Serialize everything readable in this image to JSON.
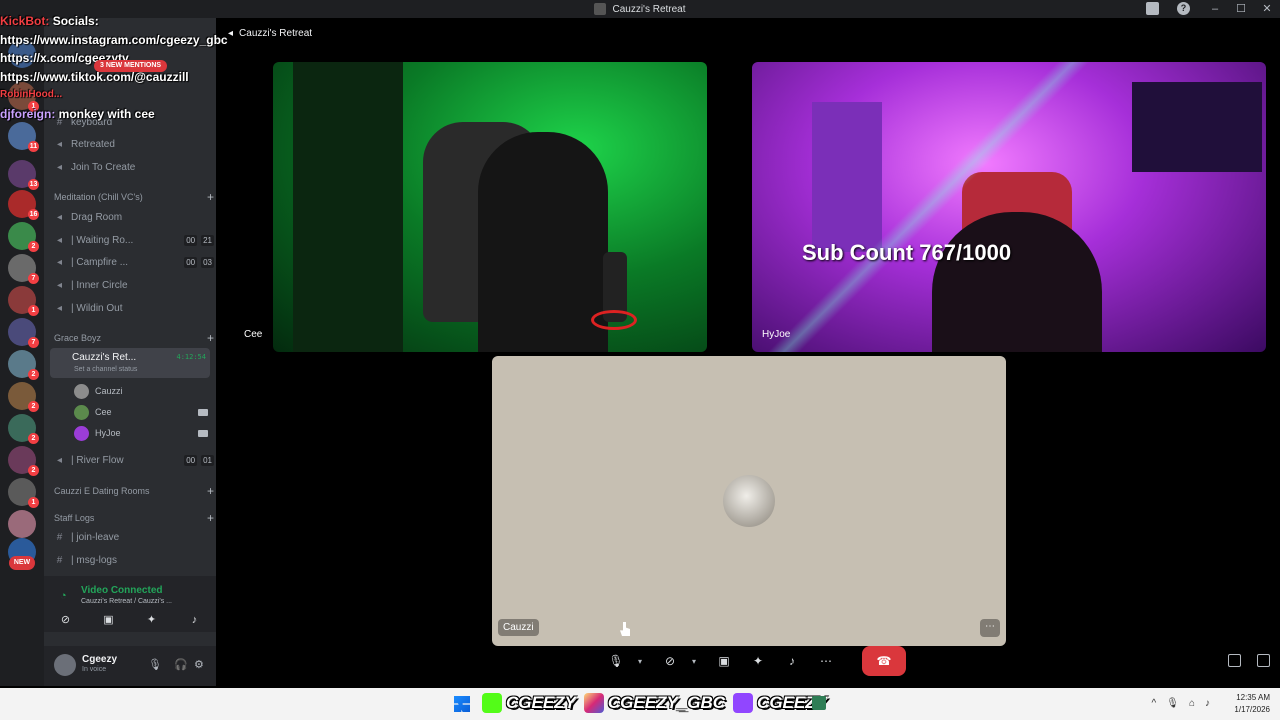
{
  "window": {
    "title": "Cauzzi's Retreat"
  },
  "stage_header": {
    "server_title": "Cauzzi's Retreat"
  },
  "overlay": {
    "kickbot_name": "KickBot:",
    "kickbot_msg": "Socials:",
    "line_instagram": "https://www.instagram.com/cgeezy_gbc",
    "line_x": "https://x.com/cgeezytv",
    "line_tiktok": "https://www.tiktok.com/@cauzzill",
    "line_partial": "RobinHood...",
    "dj_name": "djforeign:",
    "dj_msg": "monkey with cee",
    "mentions": "3 NEW MENTIONS"
  },
  "guild_badges": [
    "1",
    "11",
    "13",
    "16",
    "2",
    "7",
    "1",
    "7",
    "2",
    "2",
    "2",
    "2",
    "1"
  ],
  "guild_new": "NEW",
  "sidebar": {
    "partial_items": [
      "keyboard"
    ],
    "channels_top": [
      {
        "label": "Retreated"
      },
      {
        "label": "Join To Create"
      }
    ],
    "category_meditation": "Meditation (Chill VC's)",
    "meditation_channels": [
      {
        "label": "Drag Room",
        "c1": "",
        "c2": ""
      },
      {
        "label": "| Waiting Ro...",
        "c1": "00",
        "c2": "21"
      },
      {
        "label": "| Campfire ...",
        "c1": "00",
        "c2": "03"
      },
      {
        "label": "| Inner Circle",
        "c1": "",
        "c2": ""
      },
      {
        "label": "| Wildin Out",
        "c1": "",
        "c2": ""
      }
    ],
    "category_grace": "Grace Boyz",
    "active_channel": {
      "name": "Cauzzi's Ret...",
      "status": "Set a channel status",
      "time": "4:12:54"
    },
    "voice_users": [
      {
        "name": "Cauzzi",
        "camera": false,
        "avatar_color": "#8c8c8c"
      },
      {
        "name": "Cee",
        "camera": true,
        "avatar_color": "#5b8a4c"
      },
      {
        "name": "HyJoe",
        "camera": true,
        "avatar_color": "#9b3dd8"
      }
    ],
    "river_flow": {
      "label": "| River Flow",
      "c1": "00",
      "c2": "01"
    },
    "category_dating": "Cauzzi E Dating Rooms",
    "category_staff": "Staff Logs",
    "staff_channels": [
      {
        "label": "| join-leave"
      },
      {
        "label": "| msg-logs"
      }
    ]
  },
  "voice_panel": {
    "status": "Video Connected",
    "sub": "Cauzzi's Retreat / Cauzzi's ..."
  },
  "user_panel": {
    "username": "Cgeezy",
    "status": "In voice"
  },
  "tiles": {
    "cee": {
      "name": "Cee"
    },
    "hyjoe": {
      "name": "HyJoe"
    },
    "cauzzi": {
      "name": "Cauzzi",
      "more": "⋯"
    }
  },
  "sub_count": "Sub Count 767/1000",
  "taskbar": {
    "socials": [
      "CGEEZY",
      "CGEEZY_GBC",
      "CGEEZY"
    ],
    "time": "12:35 AM",
    "date": "1/17/2026"
  },
  "colors": {
    "connected": "#23a55a",
    "end_call": "#da373c",
    "mention": "#da373c"
  }
}
